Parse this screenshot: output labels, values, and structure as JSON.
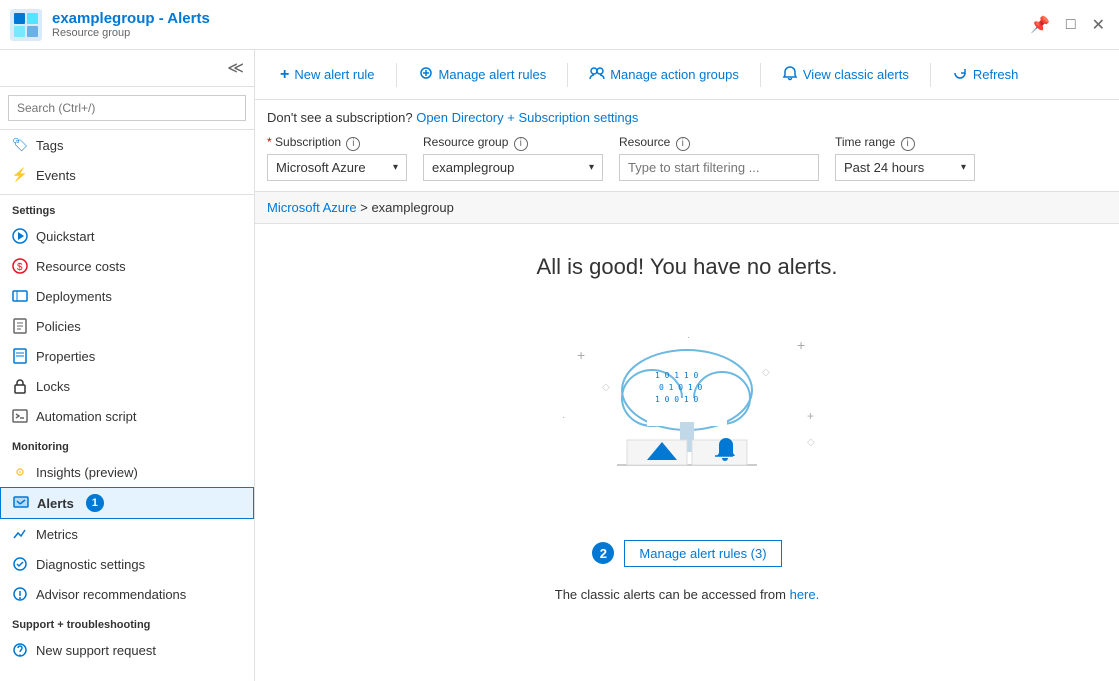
{
  "titlebar": {
    "title": "examplegroup - Alerts",
    "subtitle": "Resource group",
    "icon_color": "#0078d4"
  },
  "sidebar": {
    "search_placeholder": "Search (Ctrl+/)",
    "top_items": [
      {
        "id": "tags",
        "label": "Tags",
        "icon": "tag"
      },
      {
        "id": "events",
        "label": "Events",
        "icon": "lightning"
      }
    ],
    "sections": [
      {
        "label": "Settings",
        "items": [
          {
            "id": "quickstart",
            "label": "Quickstart",
            "icon": "quickstart"
          },
          {
            "id": "resource-costs",
            "label": "Resource costs",
            "icon": "costs"
          },
          {
            "id": "deployments",
            "label": "Deployments",
            "icon": "deployments"
          },
          {
            "id": "policies",
            "label": "Policies",
            "icon": "policies"
          },
          {
            "id": "properties",
            "label": "Properties",
            "icon": "properties"
          },
          {
            "id": "locks",
            "label": "Locks",
            "icon": "lock"
          },
          {
            "id": "automation-script",
            "label": "Automation script",
            "icon": "automation"
          }
        ]
      },
      {
        "label": "Monitoring",
        "items": [
          {
            "id": "insights",
            "label": "Insights (preview)",
            "icon": "insights"
          },
          {
            "id": "alerts",
            "label": "Alerts",
            "icon": "alerts",
            "active": true,
            "badge": "1"
          },
          {
            "id": "metrics",
            "label": "Metrics",
            "icon": "metrics"
          },
          {
            "id": "diagnostic-settings",
            "label": "Diagnostic settings",
            "icon": "diagnostic"
          },
          {
            "id": "advisor",
            "label": "Advisor recommendations",
            "icon": "advisor"
          }
        ]
      },
      {
        "label": "Support + troubleshooting",
        "items": [
          {
            "id": "new-support",
            "label": "New support request",
            "icon": "support"
          }
        ]
      }
    ]
  },
  "toolbar": {
    "new_alert_rule": "New alert rule",
    "manage_alert_rules": "Manage alert rules",
    "manage_action_groups": "Manage action groups",
    "view_classic_alerts": "View classic alerts",
    "refresh": "Refresh"
  },
  "filter": {
    "notice": "Don't see a subscription?",
    "notice_link": "Open Directory + Subscription settings",
    "subscription_label": "Subscription",
    "subscription_value": "Microsoft Azure",
    "resource_group_label": "Resource group",
    "resource_group_value": "examplegroup",
    "resource_label": "Resource",
    "resource_placeholder": "Type to start filtering ...",
    "time_range_label": "Time range",
    "time_range_value": "Past 24 hours"
  },
  "breadcrumb": {
    "parent": "Microsoft Azure",
    "current": "examplegroup"
  },
  "main": {
    "no_alerts_title": "All is good! You have no alerts.",
    "manage_link_label": "Manage alert rules (3)",
    "classic_notice": "The classic alerts can be accessed from",
    "classic_link": "here.",
    "step_number": "2"
  }
}
